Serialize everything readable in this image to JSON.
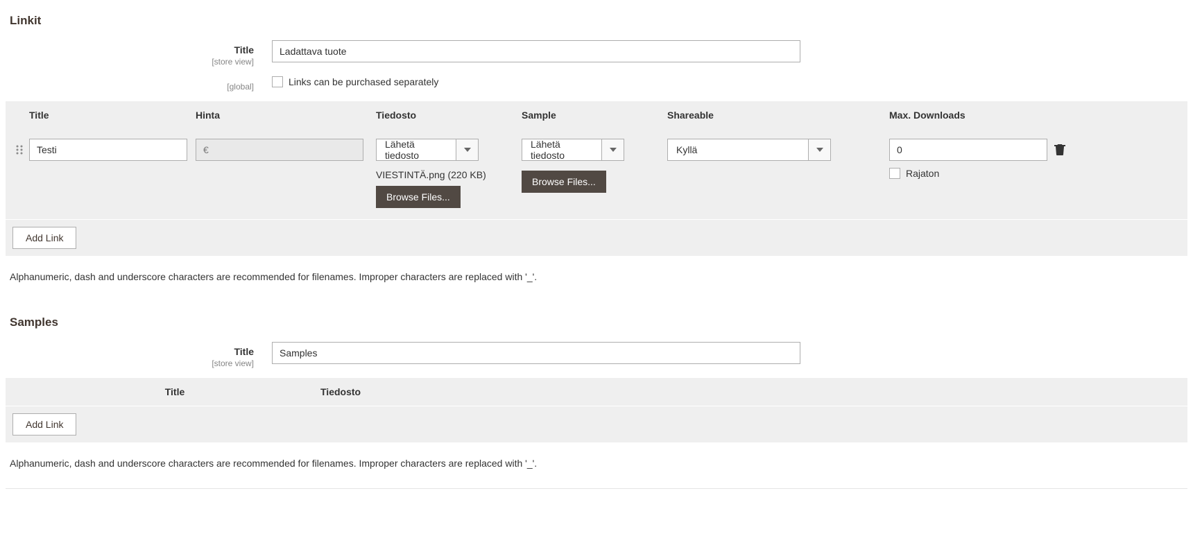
{
  "linkit": {
    "section_title": "Linkit",
    "title_label": "Title",
    "title_scope": "[store view]",
    "title_value": "Ladattava tuote",
    "global_scope": "[global]",
    "separate_label": "Links can be purchased separately",
    "columns": {
      "title": "Title",
      "price": "Hinta",
      "file": "Tiedosto",
      "sample": "Sample",
      "shareable": "Shareable",
      "max": "Max. Downloads"
    },
    "row": {
      "title": "Testi",
      "price_currency": "€",
      "file_select": "Lähetä tiedosto",
      "file_name": "VIESTINTÄ.png (220 KB)",
      "browse": "Browse Files...",
      "sample_select": "Lähetä tiedosto",
      "shareable_value": "Kyllä",
      "max_value": "0",
      "rajaton_label": "Rajaton"
    },
    "add_link": "Add Link",
    "note": "Alphanumeric, dash and underscore characters are recommended for filenames. Improper characters are replaced with '_'."
  },
  "samples": {
    "section_title": "Samples",
    "title_label": "Title",
    "title_scope": "[store view]",
    "title_value": "Samples",
    "columns": {
      "title": "Title",
      "file": "Tiedosto"
    },
    "add_link": "Add Link",
    "note": "Alphanumeric, dash and underscore characters are recommended for filenames. Improper characters are replaced with '_'."
  }
}
